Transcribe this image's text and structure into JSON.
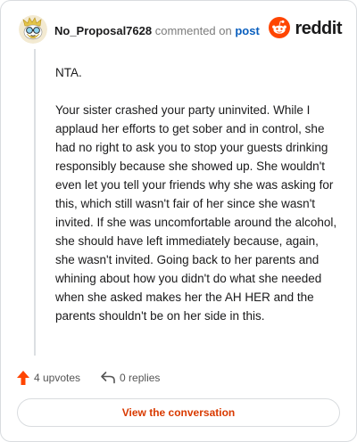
{
  "header": {
    "username": "No_Proposal7628",
    "action_text": "commented on",
    "target_text": "post",
    "logo_text": "reddit"
  },
  "comment": {
    "paragraphs": [
      "NTA.",
      "Your sister crashed your party uninvited. While I applaud her efforts to get sober and in control, she had no right to ask you to stop your guests drinking responsibly because she showed up. She wouldn't even let you tell your friends why she was asking for this, which still wasn't fair of her since she wasn't invited. If she was uncomfortable around the alcohol, she should have left immediately because, again, she wasn't invited. Going back to her parents and whining about how you didn't do what she needed when she asked makes her the AH HER and the parents shouldn't be on her side in this."
    ]
  },
  "actions": {
    "upvotes_label": "4 upvotes",
    "replies_label": "0 replies"
  },
  "cta": {
    "label": "View the conversation"
  },
  "colors": {
    "brand": "#ff4500",
    "link": "#0a5fbe",
    "cta_text": "#d93a00",
    "border": "#d9dcdf"
  },
  "icons": {
    "avatar": "snoo-avatar-icon",
    "logo": "reddit-logo-icon",
    "upvote": "upvote-arrow-icon",
    "reply": "reply-arrow-icon"
  }
}
